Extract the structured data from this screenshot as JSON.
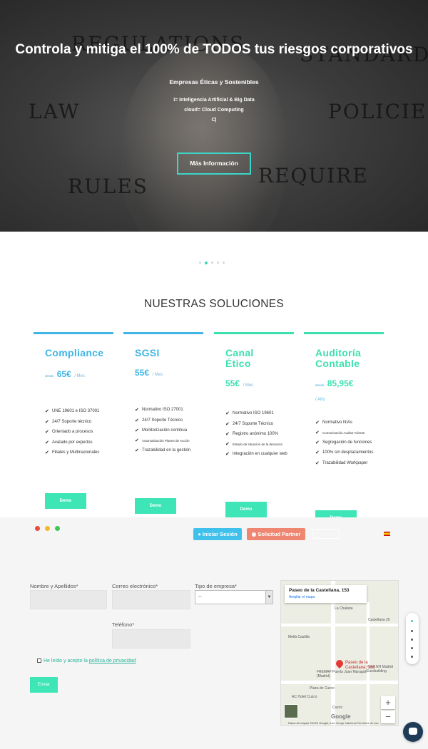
{
  "hero": {
    "title": "Controla y mitiga el 100% de TODOS tus riesgos corporativos",
    "subtitle": "Empresas Éticas y Sostenibles",
    "line1": "i= Inteligencia Artificial & Big Data",
    "line2": "cloud= Cloud Computing",
    "line3": "C|",
    "button": "Más Información",
    "background_words": [
      "REGULATIONS",
      "STANDARDS",
      "LAW",
      "POLICIES",
      "RULES",
      "REQUIRE"
    ]
  },
  "slider": {
    "count": 5,
    "active": 1
  },
  "solutions": {
    "title": "NUESTRAS SOLUCIONES",
    "cards": [
      {
        "name": "Compliance",
        "prefix": "desde",
        "price": "65€",
        "per": "/ Mes",
        "year": "",
        "color": "#3fb6e6",
        "features": [
          "UNE 19601 e ISO 37001",
          "24/7 Soporte técnico",
          "Orientado a procesos",
          "Avalado por expertos",
          "Filiales y Multinacionales"
        ],
        "button": "Demo"
      },
      {
        "name": "SGSI",
        "prefix": "",
        "price": "55€",
        "per": "/ Mes",
        "year": "",
        "color": "#3fb6e6",
        "features": [
          "Normativo ISO 27001",
          "24/7 Soporte Técnico",
          "Monitorización continua",
          "Automatización Planes de Acción",
          "Trazabilidad en la gestión"
        ],
        "button": "Demo"
      },
      {
        "name": "Canal Ético",
        "prefix": "",
        "price": "55€",
        "per": "/ Mes",
        "year": "",
        "color": "#3ee0b0",
        "features": [
          "Normativo ISO 19601",
          "24/7 Soporte Técnico",
          "Registro anónimo 100%",
          "Estado de situación de la denuncia",
          "Integración en cualquier web"
        ],
        "button": "Demo"
      },
      {
        "name": "Auditoría Contable",
        "prefix": "desde",
        "price": "85,95€",
        "per": "",
        "year": "/ Año",
        "color": "#3ee0b0",
        "features": [
          "Normativo NIAs",
          "Comunicación Auditor-Cliente",
          "Segregación de funciones",
          "100% sin desplazamientos",
          "Trazabilidad Workpaper"
        ],
        "button": "Demo"
      }
    ]
  },
  "window_dots": [
    "#e94b3c",
    "#f5b82e",
    "#3fc65a"
  ],
  "header": {
    "login": "Iniciar Sesión",
    "partner": "Solicitud Partner"
  },
  "form": {
    "name_label": "Nombre y Apellidos*",
    "email_label": "Correo electrónico*",
    "type_label": "Tipo de empresa*",
    "type_value": "--",
    "phone_label": "Teléfono*",
    "privacy_prefix": "He leído y acepto la ",
    "privacy_link": "política de privacidad",
    "submit": "Enviar"
  },
  "map": {
    "address": "Paseo de la Castellana, 153",
    "enlarge": "Ampliar el mapa",
    "pin_label": "Paseo de la Castellana, 153",
    "places": [
      "La Chalana",
      "Castellana 20",
      "Meliá Castilla",
      "FREMAP Puerta Juan Maragall (Madrid)",
      "Plaza de Cuzco",
      "AC Hotel Cuzco",
      "Hotel NH Madrid Eurobuilding",
      "Cuzco"
    ],
    "google": "Google",
    "attribution": "Datos de mapas ©2020 Google, Inst. Geogr. Nacional   Términos de uso"
  }
}
